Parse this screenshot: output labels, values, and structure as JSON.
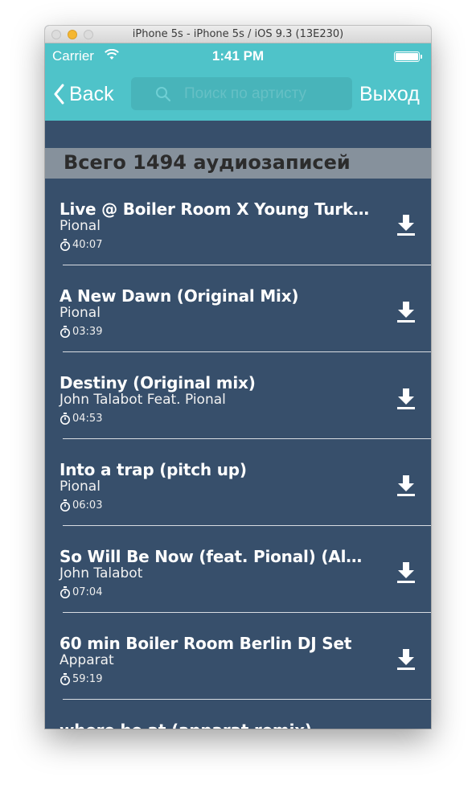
{
  "window": {
    "title": "iPhone 5s - iPhone 5s / iOS 9.3 (13E230)"
  },
  "status_bar": {
    "carrier": "Carrier",
    "time": "1:41 PM"
  },
  "nav": {
    "back_label": "Back",
    "search_placeholder": "Поиск по артисту",
    "logout_label": "Выход"
  },
  "header": {
    "text": "Всего 1494 аудиозаписей"
  },
  "tracks": [
    {
      "title": "Live @ Boiler Room X Young Turks...",
      "artist": "Pional",
      "duration": "40:07"
    },
    {
      "title": "A New Dawn (Original Mix)",
      "artist": "Pional",
      "duration": "03:39"
    },
    {
      "title": "Destiny (Original mix)",
      "artist": "John Talabot Feat. Pional",
      "duration": "04:53"
    },
    {
      "title": "Into a trap (pitch up)",
      "artist": "Pional",
      "duration": "06:03"
    },
    {
      "title": "So Will Be Now (feat. Pional) (Albu...",
      "artist": "John Talabot",
      "duration": "07:04"
    },
    {
      "title": "60 min Boiler Room Berlin DJ Set",
      "artist": "Apparat",
      "duration": "59:19"
    },
    {
      "title": "where he at (apparat remix)",
      "artist": "",
      "duration": ""
    }
  ],
  "colors": {
    "nav_bg": "#4fc3c9",
    "list_bg": "#374f6b",
    "header_bg": "#86919c"
  },
  "icons": [
    "back-chevron",
    "wifi",
    "battery",
    "search",
    "stopwatch",
    "download"
  ]
}
